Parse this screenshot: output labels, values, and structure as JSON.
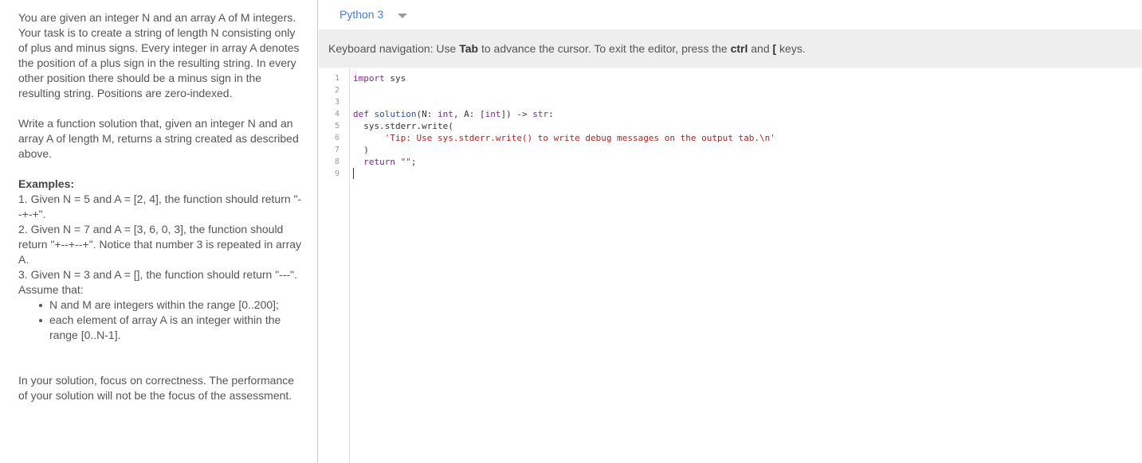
{
  "task": {
    "paragraph1": "You are given an integer N and an array A of M integers. Your task is to create a string of length N consisting only of plus and minus signs. Every integer in array A denotes the position of a plus sign in the resulting string. In every other position there should be a minus sign in the resulting string. Positions are zero-indexed.",
    "paragraph2": "Write a function solution that, given an integer N and an array A of length M, returns a string created as described above.",
    "examples_heading": "Examples:",
    "example1": "1. Given N = 5 and A = [2, 4], the function should return \"--+-+\".",
    "example2": "2. Given N = 7 and A = [3, 6, 0, 3], the function should return \"+--+--+\". Notice that number 3 is repeated in array A.",
    "example3": "3. Given N = 3 and A = [], the function should return \"---\".",
    "assume_heading": "Assume that:",
    "assumptions": [
      "N and M are integers within the range [0..200];",
      "each element of array A is an integer within the range [0..N-1]."
    ],
    "closing": "In your solution, focus on correctness. The performance of your solution will not be the focus of the assessment."
  },
  "editor": {
    "language": "Python 3",
    "keyboard_hint": {
      "prefix": "Keyboard navigation: Use ",
      "tab_key": "Tab",
      "middle": " to advance the cursor. To exit the editor, press the ",
      "ctrl_key": "ctrl",
      "and_text": " and ",
      "bracket_key": "[",
      "suffix": " keys."
    },
    "line_numbers": [
      "1",
      "2",
      "3",
      "4",
      "5",
      "6",
      "7",
      "8",
      "9"
    ],
    "code": {
      "l1_kw": "import",
      "l1_rest": " sys",
      "l4_kw": "def",
      "l4_fn": "solution",
      "l4_p1": "(N: ",
      "l4_t1": "int",
      "l4_p2": ", A: [",
      "l4_t2": "int",
      "l4_p3": "]) -> ",
      "l4_t3": "str",
      "l4_p4": ":",
      "l5": "  sys.stderr.write(",
      "l6": "'Tip: Use sys.stderr.write() to write debug messages on the output tab.\\n'",
      "l7": "  )",
      "l8_kw": "return",
      "l8_str": "\"\"",
      "l8_end": ";"
    }
  }
}
